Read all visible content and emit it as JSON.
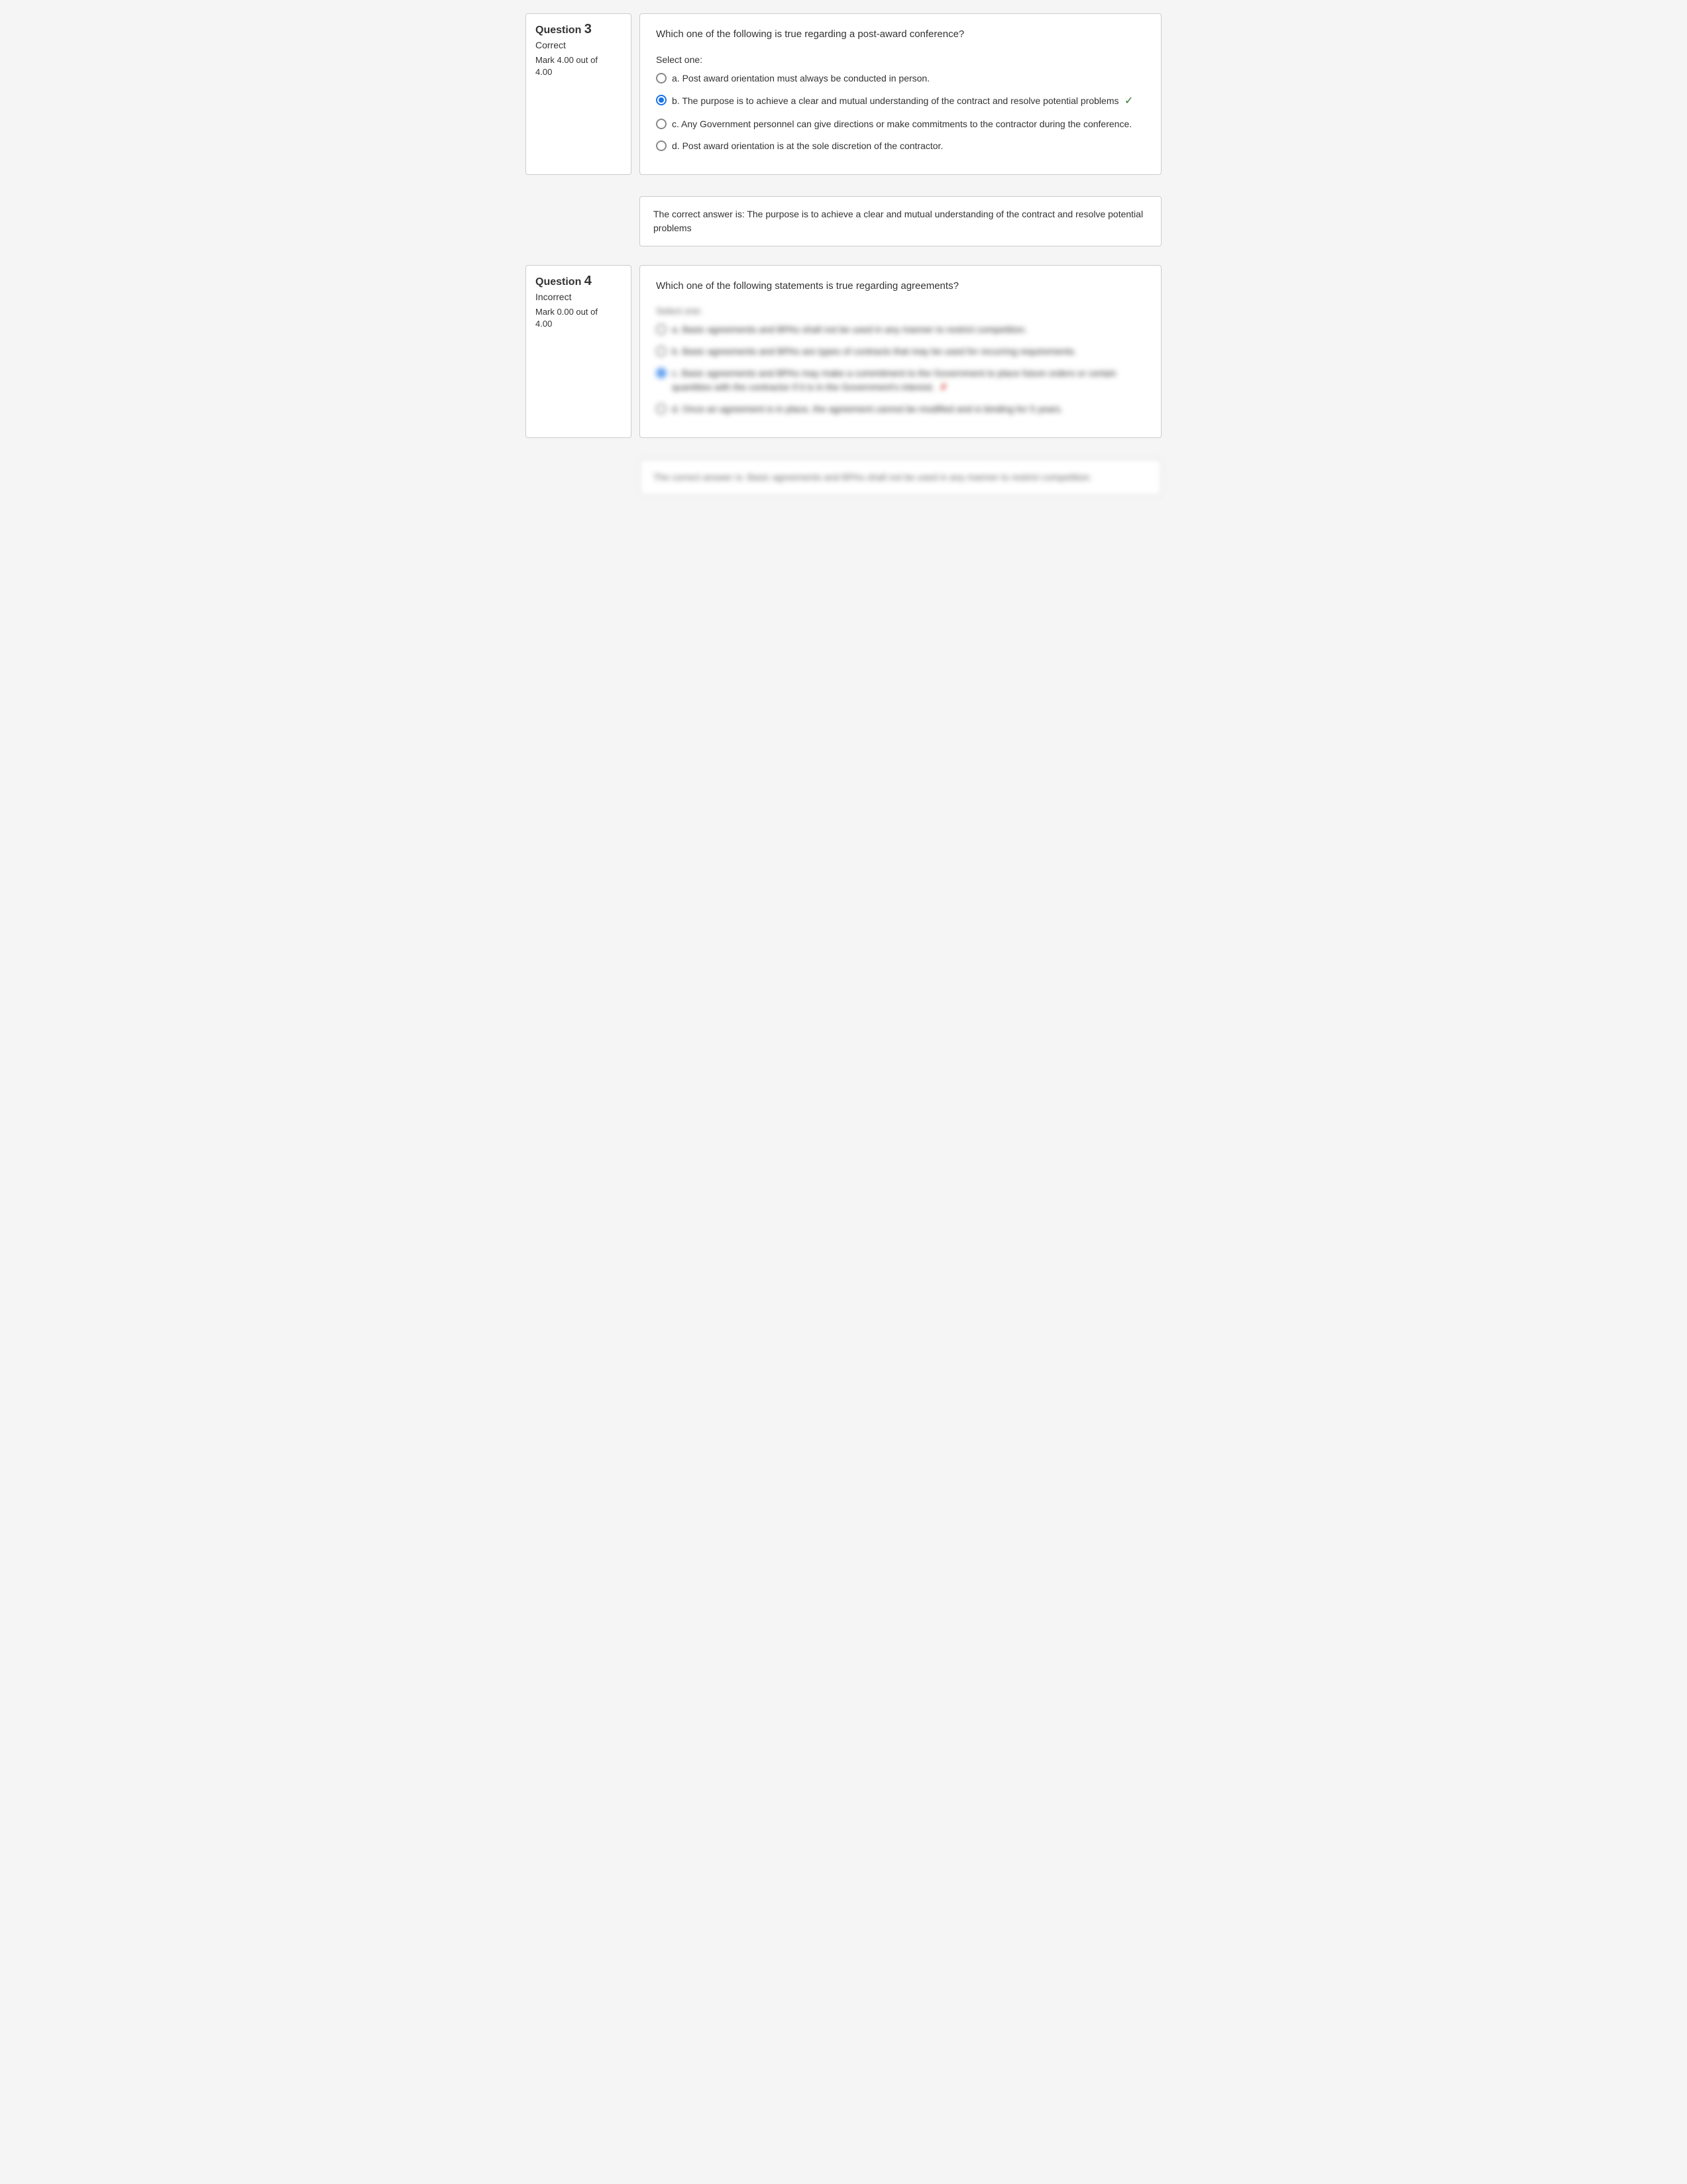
{
  "questions": [
    {
      "id": "3",
      "label": "Question",
      "number": "3",
      "status": "Correct",
      "status_type": "correct",
      "mark": "Mark 4.00 out of",
      "mark2": "4.00",
      "question_text": "Which one of the following is true regarding a post-award conference?",
      "select_label": "Select one:",
      "options": [
        {
          "letter": "a.",
          "text": "Post award orientation must always be conducted in person.",
          "selected": false,
          "correct": false,
          "blurred": false
        },
        {
          "letter": "b.",
          "text": "The purpose is to achieve a clear and mutual understanding of the contract and resolve potential problems",
          "selected": true,
          "correct": true,
          "blurred": false,
          "checkmark": "✓"
        },
        {
          "letter": "c.",
          "text": "Any Government personnel can give directions or make commitments to the contractor during the conference.",
          "selected": false,
          "correct": false,
          "blurred": false
        },
        {
          "letter": "d.",
          "text": "Post award orientation is at the sole discretion of the contractor.",
          "selected": false,
          "correct": false,
          "blurred": false
        }
      ],
      "correct_answer_prefix": "The correct answer is: ",
      "correct_answer_text": "The purpose is to achieve a clear and mutual understanding of the contract and resolve potential problems"
    },
    {
      "id": "4",
      "label": "Question",
      "number": "4",
      "status": "Incorrect",
      "status_type": "incorrect",
      "mark": "Mark 0.00 out of",
      "mark2": "4.00",
      "question_text": "Which one of the following statements is true regarding agreements?",
      "select_label": "Select one:",
      "options": [
        {
          "letter": "a.",
          "text": "Basic agreements and BPAs shall not be used in any manner to restrict competition.",
          "selected": false,
          "correct": false,
          "blurred": true
        },
        {
          "letter": "b.",
          "text": "Basic agreements and BPAs are types of contracts that may be used for recurring requirements.",
          "selected": false,
          "correct": false,
          "blurred": true
        },
        {
          "letter": "c.",
          "text": "Basic agreements and BPAs may make a commitment to the Government to place future orders or certain quantities with the contractor if it is in the Government's interest.",
          "selected": true,
          "correct": false,
          "blurred": true,
          "incorrect_mark": "✗"
        },
        {
          "letter": "d.",
          "text": "Once an agreement is in place, the agreement cannot be modified and is binding for 5 years.",
          "selected": false,
          "correct": false,
          "blurred": true
        }
      ],
      "correct_answer_prefix": "The correct answer is: ",
      "correct_answer_text": "Basic agreements and BPAs shall not be used in any manner to restrict competition.",
      "correct_answer_blurred": true
    }
  ]
}
